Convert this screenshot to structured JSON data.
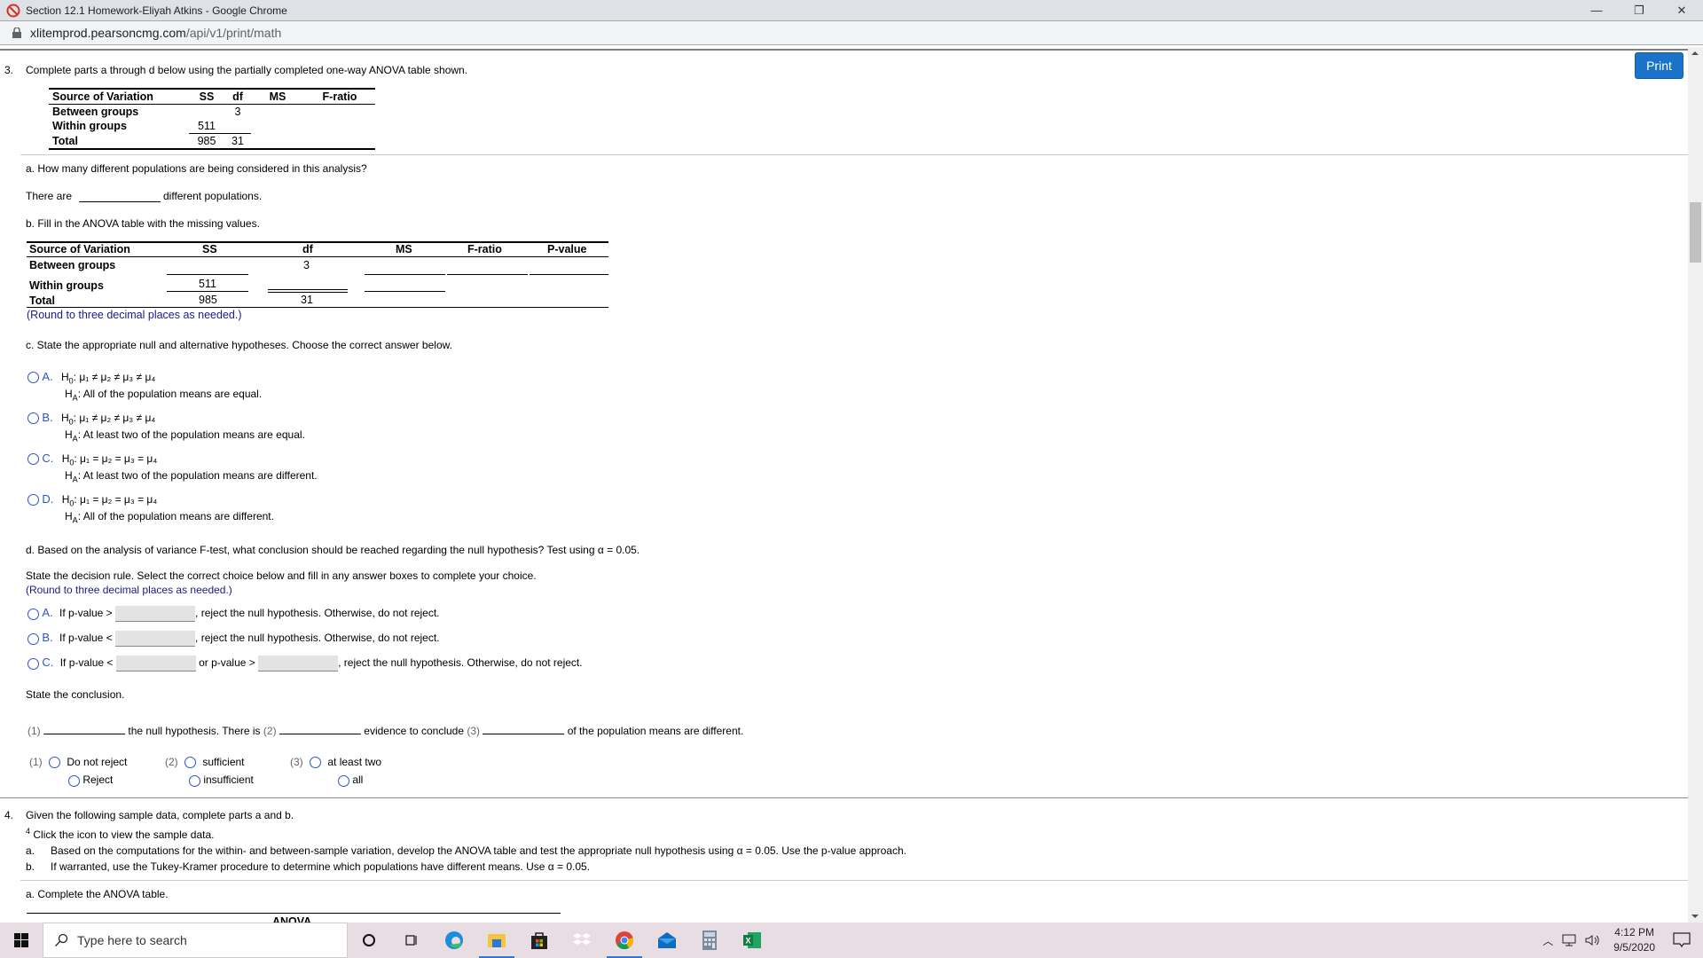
{
  "window": {
    "title": "Section 12.1 Homework-Eliyah Atkins - Google Chrome",
    "url_host": "xlitemprod.pearsoncmg.com",
    "url_path": "/api/v1/print/math",
    "controls": {
      "minimize": "—",
      "restore": "❐",
      "close": "✕"
    }
  },
  "toolbar": {
    "print_label": "Print"
  },
  "q3": {
    "number": "3.",
    "prompt": "Complete parts a through d below using the partially completed one-way ANOVA table shown.",
    "given_table": {
      "headers": [
        "Source of Variation",
        "SS",
        "df",
        "MS",
        "F-ratio"
      ],
      "rows": [
        {
          "source": "Between groups",
          "ss": "",
          "df": "3"
        },
        {
          "source": "Within groups",
          "ss": "511",
          "df": ""
        },
        {
          "source": "Total",
          "ss": "985",
          "df": "31"
        }
      ]
    },
    "part_a": {
      "question": "a. How many different populations are being considered in this analysis?",
      "before": "There are",
      "after": "different populations.",
      "answer": ""
    },
    "part_b": {
      "question": "b. Fill in the ANOVA table with the missing values.",
      "headers": [
        "Source of Variation",
        "SS",
        "df",
        "MS",
        "F-ratio",
        "P-value"
      ],
      "rows": [
        {
          "source": "Between groups",
          "ss": "",
          "df": "3",
          "ms": "",
          "f": "",
          "p": ""
        },
        {
          "source": "Within groups",
          "ss": "511",
          "df": "",
          "ms": ""
        },
        {
          "source": "Total",
          "ss": "985",
          "df": "31"
        }
      ],
      "note": "(Round to three decimal places as needed.)"
    },
    "part_c": {
      "question": "c. State the appropriate null and alternative hypotheses. Choose the correct answer below.",
      "options": [
        {
          "letter": "A.",
          "h0": "μ₁ ≠ μ₂ ≠ μ₃ ≠ μ₄",
          "ha": "All of the population means are equal."
        },
        {
          "letter": "B.",
          "h0": "μ₁ ≠ μ₂ ≠ μ₃ ≠ μ₄",
          "ha": "At least two of the population means are equal."
        },
        {
          "letter": "C.",
          "h0": "μ₁ = μ₂ = μ₃ = μ₄",
          "ha": "At least two of the population means are different."
        },
        {
          "letter": "D.",
          "h0": "μ₁ = μ₂ = μ₃ = μ₄",
          "ha": "All of the population means are different."
        }
      ],
      "h0_label": "H",
      "h0_sub": "0",
      "ha_label": "H",
      "ha_sub": "A"
    },
    "part_d": {
      "question": "d. Based on the analysis of variance F-test, what conclusion should be reached regarding the null hypothesis? Test using α = 0.05.",
      "rule_prompt": "State the decision rule. Select the correct choice below and fill in any answer boxes to complete your choice.",
      "rule_note": "(Round to three decimal places as needed.)",
      "rules": [
        {
          "letter": "A.",
          "pre": "If p-value >",
          "post": ", reject the null hypothesis. Otherwise, do not reject."
        },
        {
          "letter": "B.",
          "pre": "If p-value <",
          "post": ", reject the null hypothesis. Otherwise, do not reject."
        },
        {
          "letter": "C.",
          "pre": "If p-value <",
          "mid": "or p-value >",
          "post": ", reject the null hypothesis. Otherwise, do not reject."
        }
      ],
      "conclusion_prompt": "State the conclusion.",
      "sentence": {
        "b1": "(1)",
        "t1": "the null hypothesis. There is",
        "b2": "(2)",
        "t2": "evidence to conclude",
        "b3": "(3)",
        "t3": "of the population means are different."
      },
      "choices": [
        {
          "label": "(1)",
          "options": [
            "Do not reject",
            "Reject"
          ]
        },
        {
          "label": "(2)",
          "options": [
            "sufficient",
            "insufficient"
          ]
        },
        {
          "label": "(3)",
          "options": [
            "at least two",
            "all"
          ]
        }
      ]
    }
  },
  "q4": {
    "number": "4.",
    "prompt": "Given the following sample data, complete parts a and b.",
    "icon_note_sup": "4",
    "icon_note": "Click the icon to view the sample data.",
    "items": [
      {
        "letter": "a.",
        "text": "Based on the computations for the within- and between-sample variation, develop the ANOVA table and test the appropriate null hypothesis using α = 0.05. Use the p-value approach."
      },
      {
        "letter": "b.",
        "text": "If warranted, use the Tukey-Kramer procedure to determine which populations have different means. Use α = 0.05."
      }
    ],
    "part_a": "a. Complete the ANOVA table.",
    "table_title": "ANOVA"
  },
  "taskbar": {
    "search_placeholder": "Type here to search",
    "time": "4:12 PM",
    "date": "9/5/2020"
  }
}
